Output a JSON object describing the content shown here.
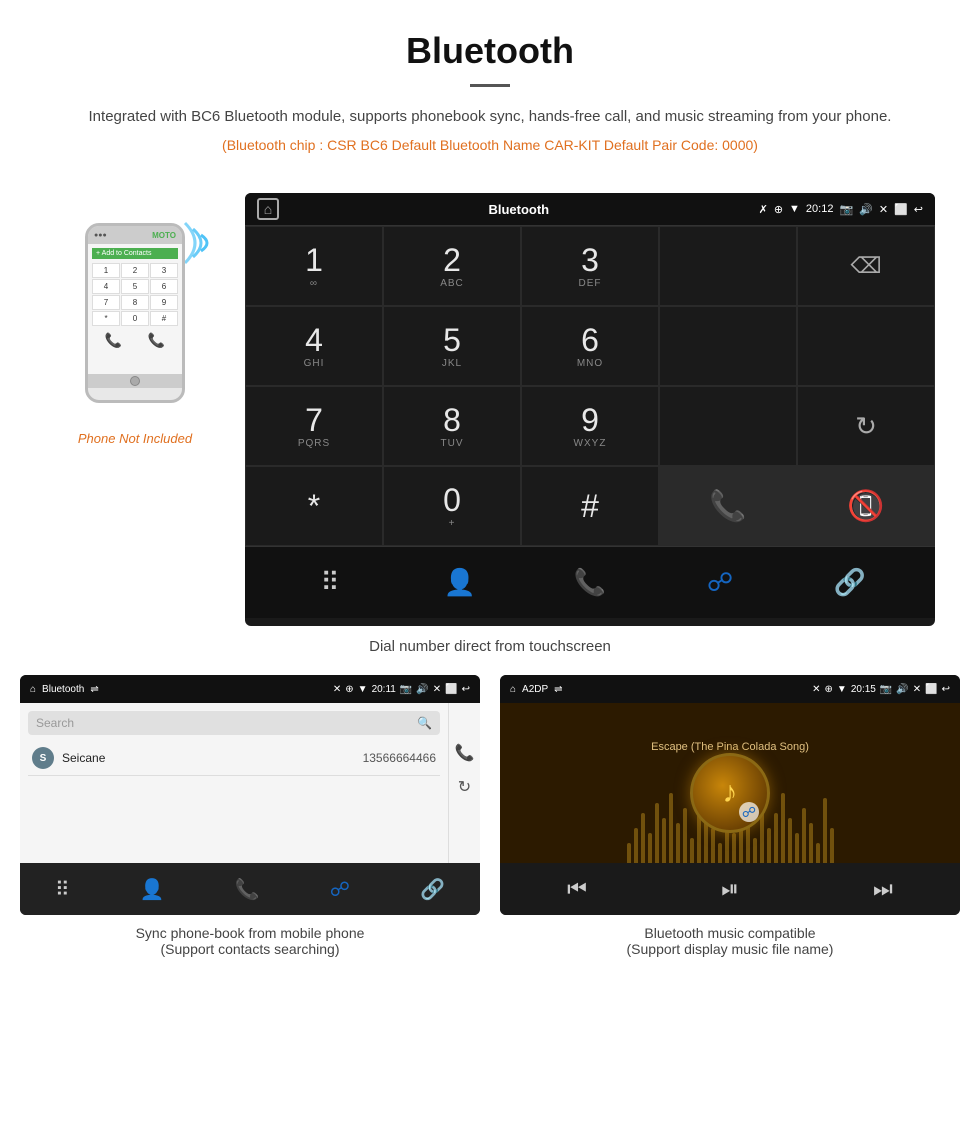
{
  "header": {
    "title": "Bluetooth",
    "description": "Integrated with BC6 Bluetooth module, supports phonebook sync, hands-free call, and music streaming from your phone.",
    "specs": "(Bluetooth chip : CSR BC6    Default Bluetooth Name CAR-KIT    Default Pair Code: 0000)"
  },
  "phone_note": "Phone Not Included",
  "dial_screen": {
    "status_bar": {
      "app_name": "Bluetooth",
      "time": "20:12"
    },
    "keys": [
      {
        "number": "1",
        "letters": "∞"
      },
      {
        "number": "2",
        "letters": "ABC"
      },
      {
        "number": "3",
        "letters": "DEF"
      },
      {
        "number": "4",
        "letters": "GHI"
      },
      {
        "number": "5",
        "letters": "JKL"
      },
      {
        "number": "6",
        "letters": "MNO"
      },
      {
        "number": "7",
        "letters": "PQRS"
      },
      {
        "number": "8",
        "letters": "TUV"
      },
      {
        "number": "9",
        "letters": "WXYZ"
      },
      {
        "number": "*",
        "letters": ""
      },
      {
        "number": "0",
        "letters": "+"
      },
      {
        "number": "#",
        "letters": ""
      }
    ]
  },
  "dial_caption": "Dial number direct from touchscreen",
  "phonebook_screen": {
    "status_bar": {
      "app_name": "Bluetooth",
      "time": "20:11"
    },
    "search_placeholder": "Search",
    "contacts": [
      {
        "initial": "S",
        "name": "Seicane",
        "number": "13566664466"
      }
    ]
  },
  "phonebook_caption_line1": "Sync phone-book from mobile phone",
  "phonebook_caption_line2": "(Support contacts searching)",
  "music_screen": {
    "status_bar": {
      "app_name": "A2DP",
      "time": "20:15"
    },
    "song_title": "Escape (The Pina Colada Song)"
  },
  "music_caption_line1": "Bluetooth music compatible",
  "music_caption_line2": "(Support display music file name)"
}
